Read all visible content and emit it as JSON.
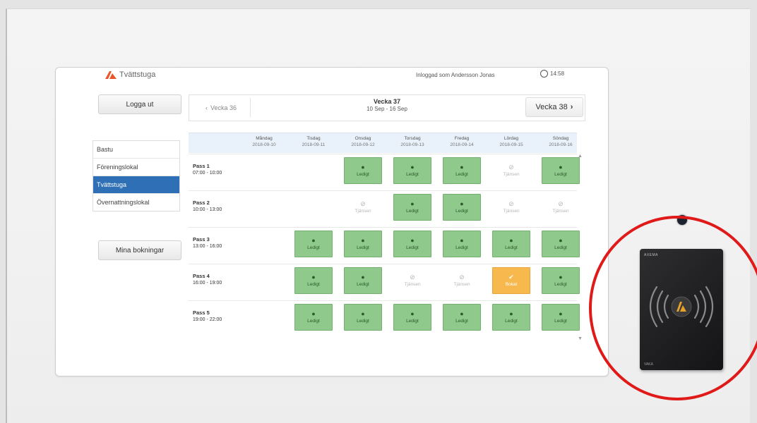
{
  "app": {
    "name": "Tvättstuga",
    "logged_in_text": "Inloggad som Andersson Jonas",
    "time": "14:58"
  },
  "buttons": {
    "logout": "Logga ut",
    "my_bookings": "Mina bokningar"
  },
  "menu": [
    {
      "label": "Bastu",
      "active": false
    },
    {
      "label": "Föreningslokal",
      "active": false
    },
    {
      "label": "Tvättstuga",
      "active": true
    },
    {
      "label": "Övernattningslokal",
      "active": false
    }
  ],
  "week_nav": {
    "prev_label": "Vecka 36",
    "title": "Vecka 37",
    "range": "10 Sep - 16 Sep",
    "next_label": "Vecka 38"
  },
  "days": [
    {
      "name": "Måndag",
      "date": "2018-09-10"
    },
    {
      "name": "Tisdag",
      "date": "2018-09-11"
    },
    {
      "name": "Onsdag",
      "date": "2018-09-12"
    },
    {
      "name": "Torsdag",
      "date": "2018-09-13"
    },
    {
      "name": "Fredag",
      "date": "2018-09-14"
    },
    {
      "name": "Lördag",
      "date": "2018-09-15"
    },
    {
      "name": "Söndag",
      "date": "2018-09-16"
    }
  ],
  "status_labels": {
    "free": "Ledigt",
    "past": "Tjänsen",
    "booked": "Bokat"
  },
  "passes": [
    {
      "name": "Pass 1",
      "time": "07:00 - 10:00",
      "cells": [
        "none",
        "none",
        "free",
        "free",
        "free",
        "past",
        "free"
      ]
    },
    {
      "name": "Pass 2",
      "time": "10:00 - 13:00",
      "cells": [
        "none",
        "none",
        "past",
        "free",
        "free",
        "past",
        "past"
      ]
    },
    {
      "name": "Pass 3",
      "time": "13:00 - 16:00",
      "cells": [
        "none",
        "free",
        "free",
        "free",
        "free",
        "free",
        "free"
      ]
    },
    {
      "name": "Pass 4",
      "time": "16:00 - 19:00",
      "cells": [
        "none",
        "free",
        "free",
        "past",
        "past",
        "booked",
        "free"
      ]
    },
    {
      "name": "Pass 5",
      "time": "19:00 - 22:00",
      "cells": [
        "none",
        "free",
        "free",
        "free",
        "free",
        "free",
        "free"
      ]
    }
  ],
  "reader": {
    "brand": "AXEMA",
    "model": "VAKA"
  },
  "colors": {
    "free": "#8fc98b",
    "booked": "#f7b84e",
    "active_menu": "#2f6fb5",
    "logo": "#e8562a",
    "highlight": "#e01919"
  }
}
